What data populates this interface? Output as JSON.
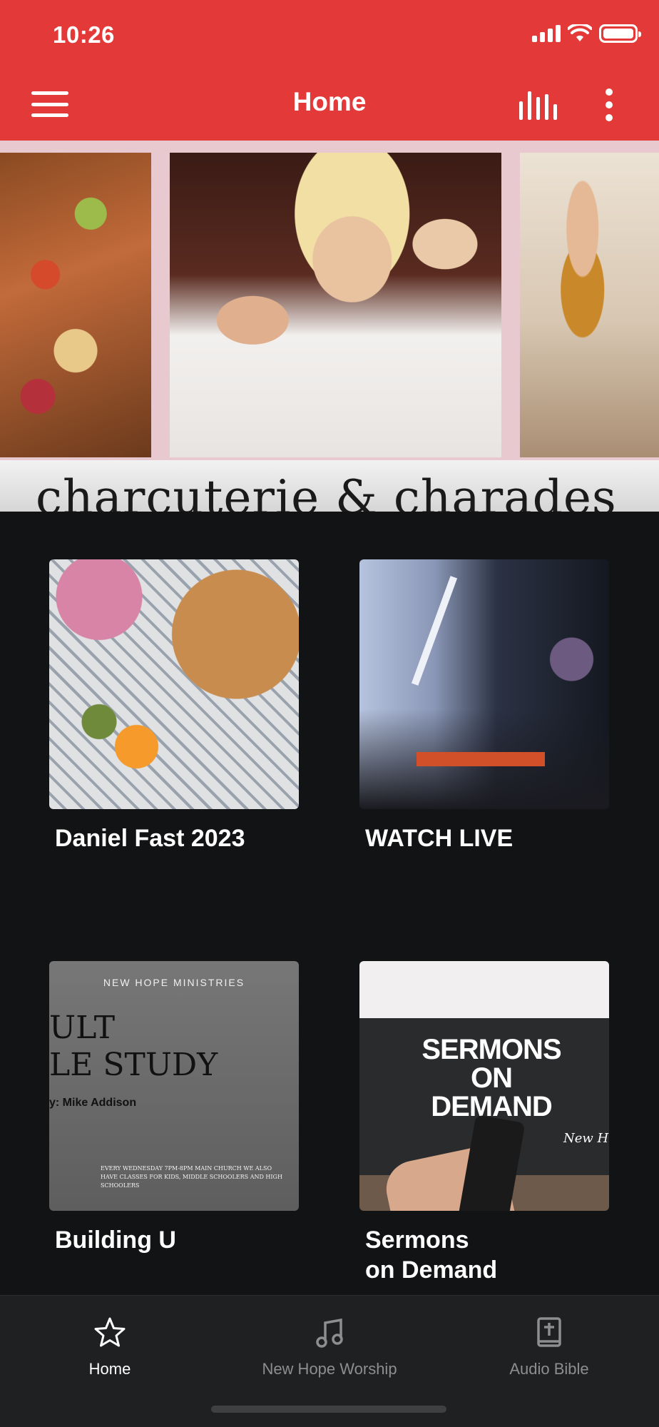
{
  "status_bar": {
    "time": "10:26"
  },
  "header": {
    "title": "Home",
    "menu_icon": "hamburger-menu-icon",
    "stats_icon": "equalizer-icon",
    "more_icon": "vertical-ellipsis-icon"
  },
  "banner": {
    "caption": "charcuterie & charades"
  },
  "tiles": [
    {
      "label": "Daniel Fast 2023"
    },
    {
      "label": "WATCH LIVE"
    },
    {
      "label": "Building U"
    },
    {
      "label": "Sermons\non Demand"
    }
  ],
  "tile_images": {
    "building": {
      "top": "NEW HOPE MINISTRIES",
      "line1": "ULT",
      "line2": "LE STUDY",
      "by": "y: Mike Addison",
      "footer": "EVERY WEDNESDAY 7PM-8PM MAIN CHURCH WE ALSO HAVE CLASSES FOR KIDS, MIDDLE SCHOOLERS AND HIGH SCHOOLERS"
    },
    "sermons": {
      "title": "SERMONS ON DEMAND",
      "tag": "New H"
    }
  },
  "tabbar": {
    "items": [
      {
        "label": "Home",
        "icon": "star-icon",
        "active": true
      },
      {
        "label": "New Hope Worship",
        "icon": "music-note-icon",
        "active": false
      },
      {
        "label": "Audio Bible",
        "icon": "bible-icon",
        "active": false
      }
    ]
  },
  "colors": {
    "header_bg": "#e33a39",
    "page_bg": "#121314",
    "tabbar_bg": "#1f2021",
    "tab_active": "#ffffff",
    "tab_inactive": "#8d8e90"
  }
}
